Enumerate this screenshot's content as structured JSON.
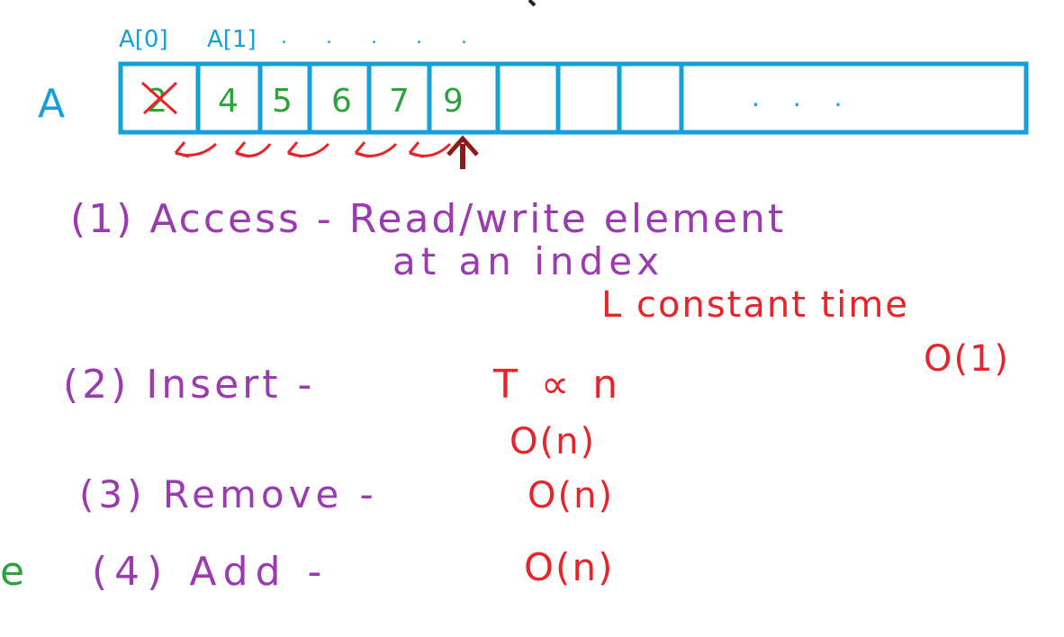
{
  "colors": {
    "blue": "#14a0d8",
    "green": "#2aa33a",
    "purple": "#9a3cb0",
    "red": "#e8232a",
    "darkred": "#8b1a1a"
  },
  "array": {
    "name": "A",
    "index_labels": [
      "A[0]",
      "A[1]",
      ". . . . ."
    ],
    "cells": [
      "2",
      "4",
      "5",
      "6",
      "7",
      "9",
      "",
      "",
      ""
    ],
    "crossed_cell_index": 0,
    "ellipsis": ". . ."
  },
  "operations": [
    {
      "label": "(1) Access - Read/write element",
      "continuation": "at an index",
      "note": "L constant time",
      "complexity": "O(1)"
    },
    {
      "label": "(2) Insert -",
      "note": "T ∝ n",
      "complexity": "O(n)"
    },
    {
      "label": "(3) Remove -",
      "complexity": "O(n)"
    },
    {
      "label": "(4) Add -",
      "complexity": "O(n)"
    }
  ],
  "edge_text": "e"
}
